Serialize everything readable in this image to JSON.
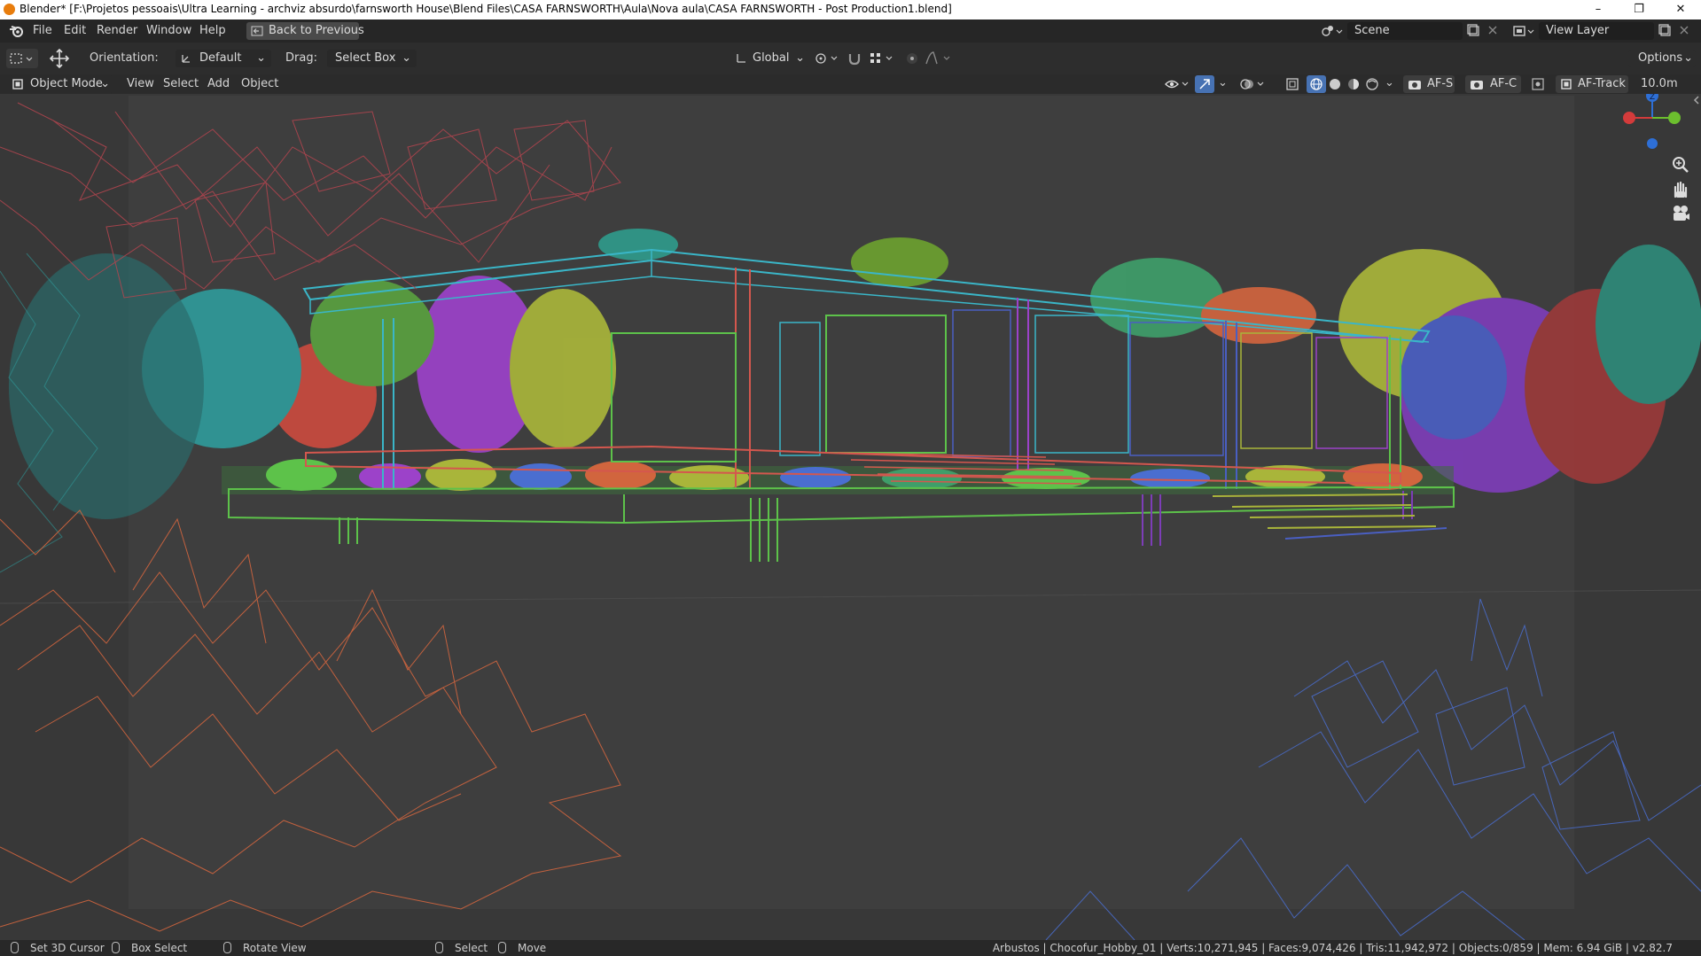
{
  "title_bar": {
    "title": "Blender* [F:\\Projetos pessoais\\Ultra Learning - archviz absurdo\\farnsworth House\\Blend Files\\CASA FARNSWORTH\\Aula\\Nova aula\\CASA FARNSWORTH - Post Production1.blend]",
    "minimize": "–",
    "restore": "❐",
    "close": "✕"
  },
  "menu": {
    "items": [
      "File",
      "Edit",
      "Render",
      "Window",
      "Help"
    ],
    "back_button": "Back to Previous",
    "scene_label": "Scene",
    "view_layer_label": "View Layer"
  },
  "tool_header": {
    "orientation_label": "Orientation:",
    "orientation_value": "Default",
    "drag_label": "Drag:",
    "drag_value": "Select Box",
    "transform_orientation": "Global",
    "options": "Options"
  },
  "view_header": {
    "mode": "Object Mode",
    "menus": [
      "View",
      "Select",
      "Add",
      "Object"
    ],
    "af_s": "AF-S",
    "af_c": "AF-C",
    "af_track": "AF-Track",
    "focal_distance": "10.0m"
  },
  "gizmo": {
    "axis_z": "Z"
  },
  "status_bar": {
    "set_cursor": "Set 3D Cursor",
    "box_select": "Box Select",
    "rotate_view": "Rotate View",
    "select": "Select",
    "move": "Move",
    "stats": "Arbustos | Chocofur_Hobby_01 | Verts:10,271,945 | Faces:9,074,426 | Tris:11,942,972 | Objects:0/859 | Mem: 6.94 GiB | v2.82.7"
  },
  "colors": {
    "viewport_bg": "#383838",
    "camera_frame": "#3e3e3e",
    "house_cyan": "#3ab6c8",
    "house_red": "#d4574e",
    "house_purple": "#9c42c9",
    "house_green": "#5dc24a",
    "tree_yellow": "#a9b53a",
    "tree_orange": "#d1653e",
    "tree_blue": "#4a6ed0",
    "accent_blue": "#4772b3"
  }
}
